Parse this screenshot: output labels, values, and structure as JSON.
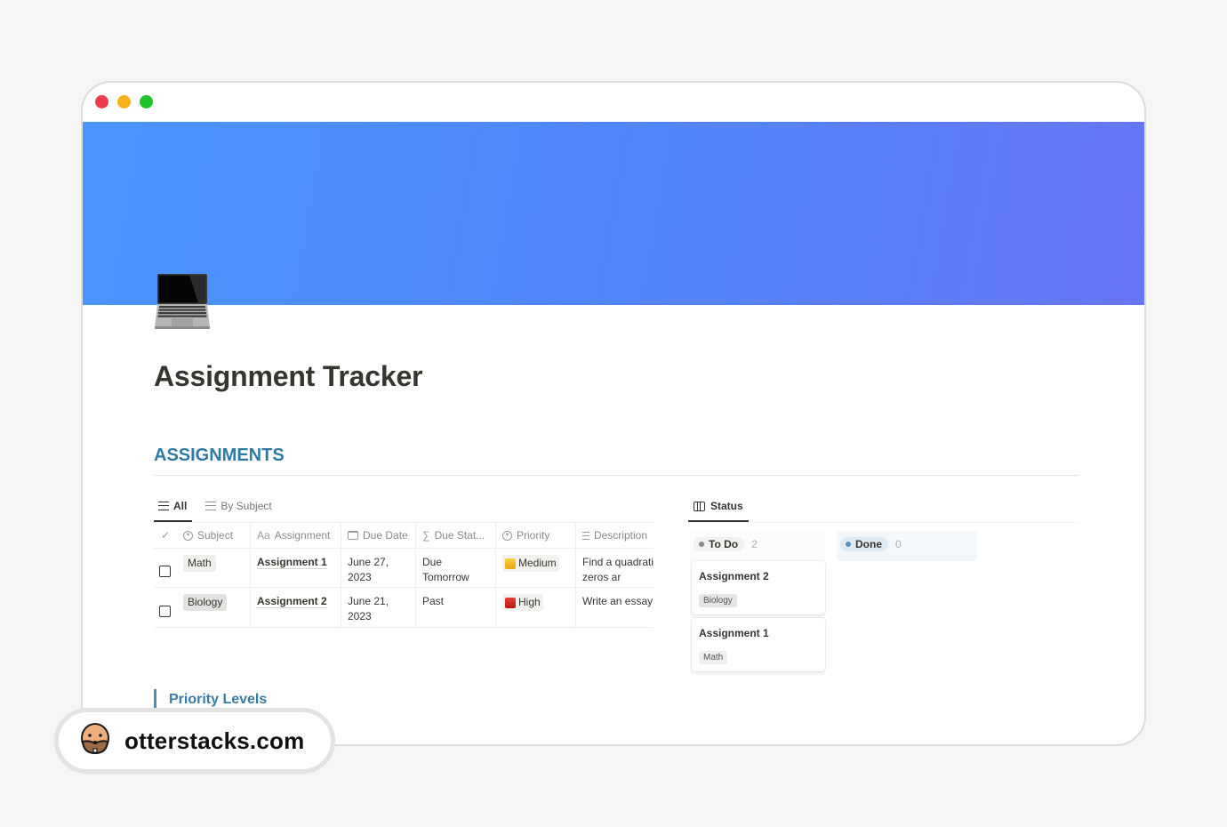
{
  "window": {
    "controls": [
      "close",
      "minimize",
      "maximize"
    ],
    "colors": {
      "close": "#ee3e4c",
      "minimize": "#f6b21a",
      "maximize": "#1ec42a"
    }
  },
  "cover": {
    "gradient_start": "#4a95fb",
    "gradient_end": "#6676f8"
  },
  "page": {
    "icon": "laptop-icon",
    "title": "Assignment Tracker"
  },
  "assignments": {
    "heading": "ASSIGNMENTS",
    "heading_color": "#2e7aa3",
    "table_view": {
      "tabs": [
        {
          "label": "All",
          "icon": "list-icon",
          "active": true
        },
        {
          "label": "By Subject",
          "icon": "list-icon",
          "active": false
        }
      ],
      "columns": [
        {
          "label": "",
          "icon": "check-icon"
        },
        {
          "label": "Subject",
          "icon": "select-icon"
        },
        {
          "label": "Assignment",
          "icon": "title-aa-icon",
          "icon_text": "Aa"
        },
        {
          "label": "Due Date",
          "icon": "calendar-icon"
        },
        {
          "label": "Due Stat...",
          "icon": "formula-sigma-icon",
          "icon_text": "∑"
        },
        {
          "label": "Priority",
          "icon": "select-icon"
        },
        {
          "label": "Description",
          "icon": "text-lines-icon"
        }
      ],
      "rows": [
        {
          "done": false,
          "subject": "Math",
          "assignment": "Assignment 1",
          "due_date": "June 27, 2023",
          "due_status": "Due Tomorrow",
          "priority": "Medium",
          "priority_color": "#f0be25",
          "description": "Find a quadrati whose zeros ar"
        },
        {
          "done": false,
          "subject": "Biology",
          "assignment": "Assignment 2",
          "due_date": "June 21, 2023",
          "due_status": "Past",
          "priority": "High",
          "priority_color": "#d3291f",
          "description": "Write an essay"
        }
      ]
    },
    "board_view": {
      "tab_label": "Status",
      "tab_icon": "board-icon",
      "columns": [
        {
          "label": "To Do",
          "count": "2",
          "color": "#8b8a87",
          "cards": [
            {
              "title": "Assignment 2",
              "tag": "Biology"
            },
            {
              "title": "Assignment 1",
              "tag": "Math"
            }
          ]
        },
        {
          "label": "Done",
          "count": "0",
          "color": "#5a93bf",
          "cards": []
        }
      ]
    }
  },
  "priority_levels": {
    "heading": "Priority Levels"
  },
  "watermark": {
    "text": "otterstacks.com",
    "icon": "otter-face-icon"
  }
}
